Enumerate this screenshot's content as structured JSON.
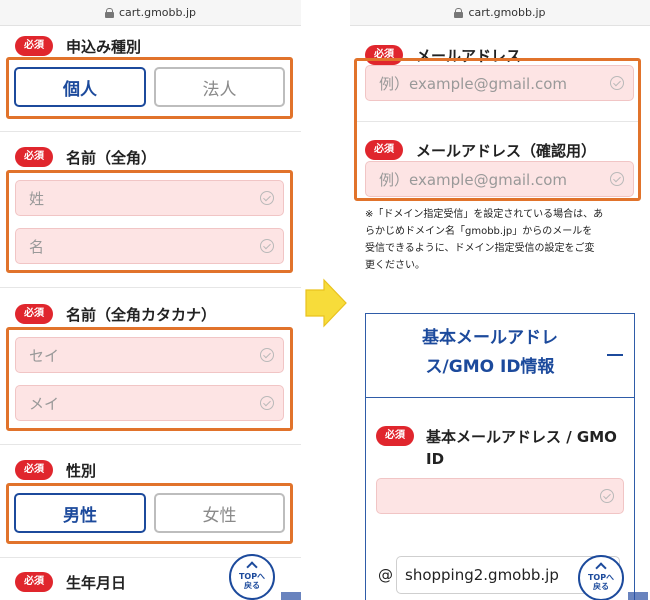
{
  "url": "cart.gmobb.jp",
  "required_badge": "必須",
  "left": {
    "application_type": {
      "label": "申込み種別",
      "options": [
        "個人",
        "法人"
      ],
      "selected": "個人"
    },
    "name": {
      "label": "名前（全角）",
      "last_placeholder": "姓",
      "first_placeholder": "名"
    },
    "name_kana": {
      "label": "名前（全角カタカナ）",
      "last_placeholder": "セイ",
      "first_placeholder": "メイ"
    },
    "gender": {
      "label": "性別",
      "options": [
        "男性",
        "女性"
      ],
      "selected": "男性"
    },
    "birthdate": {
      "label": "生年月日"
    }
  },
  "right": {
    "email": {
      "label": "メールアドレス",
      "placeholder": "例）example@gmail.com"
    },
    "email_confirm": {
      "label": "メールアドレス（確認用）",
      "placeholder": "例）example@gmail.com"
    },
    "note_lines": [
      "※「ドメイン指定受信」を設定されている場合は、あ",
      "らかじめドメイン名「gmobb.jp」からのメールを",
      "受信できるように、ドメイン指定受信の設定をご変",
      "更ください。"
    ],
    "panel": {
      "title_lines": [
        "基本メールアドレ",
        "ス/GMO ID情報"
      ],
      "field_label_lines": [
        "基本メールアドレス / GMO",
        "ID"
      ],
      "field_value": "",
      "at_sign": "@",
      "domain_value": "shopping2.gmobb.jp"
    }
  },
  "top_button": {
    "line1": "TOPへ",
    "line2": "戻る"
  },
  "colors": {
    "accent": "#e1732b",
    "brand": "#1c4a9c",
    "required": "#e0262d",
    "field_bg": "#fde4e4",
    "arrow": "#f7dc3a"
  }
}
